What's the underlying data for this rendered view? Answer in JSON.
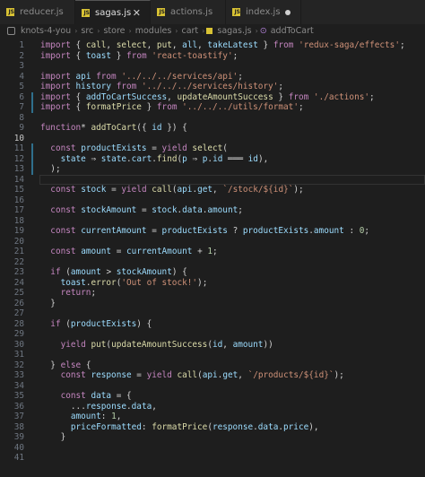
{
  "tabs": [
    {
      "label": "reducer.js",
      "active": false
    },
    {
      "label": "sagas.js",
      "active": true
    },
    {
      "label": "actions.js",
      "active": false
    },
    {
      "label": "index.js",
      "active": false,
      "dirty": true
    }
  ],
  "breadcrumb": [
    "knots-4-you",
    "src",
    "store",
    "modules",
    "cart",
    "sagas.js",
    "addToCart"
  ],
  "code": [
    {
      "n": "1",
      "t": "import { call, select, put, all, takeLatest } from 'redux-saga/effects';"
    },
    {
      "n": "2",
      "t": "import { toast } from 'react-toastify';"
    },
    {
      "n": "3",
      "t": ""
    },
    {
      "n": "4",
      "t": "import api from '../../../services/api';"
    },
    {
      "n": "5",
      "t": "import history from '../../../services/history';"
    },
    {
      "n": "6",
      "t": "import { addToCartSuccess, updateAmountSuccess } from './actions';"
    },
    {
      "n": "7",
      "t": "import { formatPrice } from '../../../utils/format';"
    },
    {
      "n": "8",
      "t": ""
    },
    {
      "n": "9",
      "t": "function* addToCart({ id }) {"
    },
    {
      "n": "10",
      "t": ""
    },
    {
      "n": "11",
      "t": "  const productExists = yield select("
    },
    {
      "n": "12",
      "t": "    state ⇒ state.cart.find(p ⇒ p.id ═══ id),"
    },
    {
      "n": "13",
      "t": "  );"
    },
    {
      "n": "14",
      "t": ""
    },
    {
      "n": "15",
      "t": "  const stock = yield call(api.get, `/stock/${id}`);"
    },
    {
      "n": "16",
      "t": ""
    },
    {
      "n": "17",
      "t": "  const stockAmount = stock.data.amount;"
    },
    {
      "n": "18",
      "t": ""
    },
    {
      "n": "19",
      "t": "  const currentAmount = productExists ? productExists.amount : 0;"
    },
    {
      "n": "20",
      "t": ""
    },
    {
      "n": "21",
      "t": "  const amount = currentAmount + 1;"
    },
    {
      "n": "22",
      "t": ""
    },
    {
      "n": "23",
      "t": "  if (amount > stockAmount) {"
    },
    {
      "n": "24",
      "t": "    toast.error('Out of stock!');"
    },
    {
      "n": "25",
      "t": "    return;"
    },
    {
      "n": "26",
      "t": "  }"
    },
    {
      "n": "27",
      "t": ""
    },
    {
      "n": "28",
      "t": "  if (productExists) {"
    },
    {
      "n": "29",
      "t": ""
    },
    {
      "n": "30",
      "t": "    yield put(updateAmountSuccess(id, amount))"
    },
    {
      "n": "31",
      "t": ""
    },
    {
      "n": "32",
      "t": "  } else {"
    },
    {
      "n": "33",
      "t": "    const response = yield call(api.get, `/products/${id}`);"
    },
    {
      "n": "34",
      "t": ""
    },
    {
      "n": "35",
      "t": "    const data = {"
    },
    {
      "n": "36",
      "t": "      ...response.data,"
    },
    {
      "n": "37",
      "t": "      amount: 1,"
    },
    {
      "n": "38",
      "t": "      priceFormatted: formatPrice(response.data.price),"
    },
    {
      "n": "39",
      "t": "    }"
    },
    {
      "n": "40",
      "t": ""
    },
    {
      "n": "41",
      "t": ""
    }
  ],
  "colors": {
    "background": "#1e1e1e",
    "keyword": "#c586c0",
    "variable": "#9cdcfe",
    "string": "#ce9178",
    "function": "#dcdcaa"
  }
}
